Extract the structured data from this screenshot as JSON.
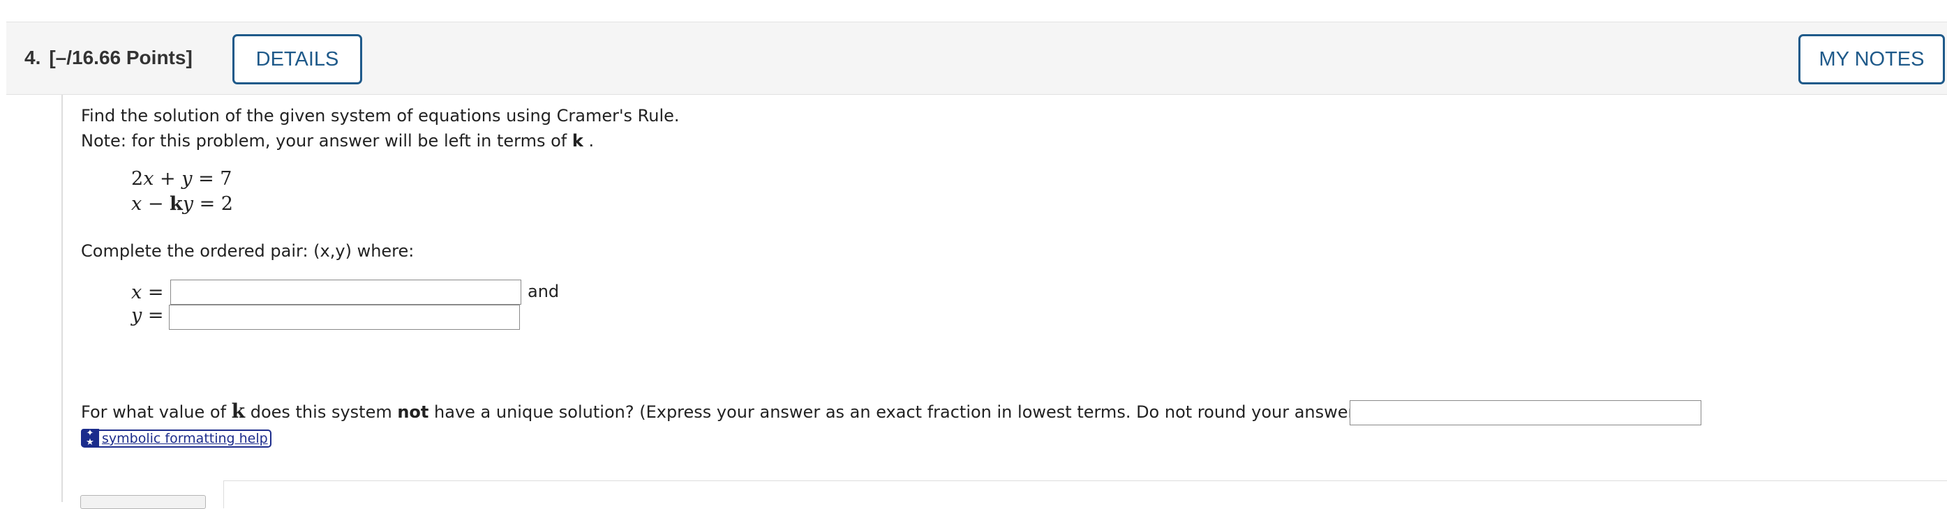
{
  "header": {
    "question_number": "4.",
    "points": "[–/16.66 Points]",
    "details_label": "DETAILS",
    "my_notes_label": "MY NOTES"
  },
  "problem": {
    "instruction": "Find the solution of the given system of equations using Cramer's Rule.",
    "note_prefix": "Note: for this problem, your answer will be left in terms of ",
    "note_k": "k",
    "note_suffix": " .",
    "equations": [
      {
        "a": "2",
        "v1": "x",
        "op": " + ",
        "v2": "y",
        "rhs": " = 7"
      },
      {
        "v1": "x",
        "op": " − ",
        "k": "k",
        "v2": "y",
        "rhs": " = 2"
      }
    ],
    "pair_prompt": "Complete the ordered pair: (x,y) where:",
    "x_label_var": "x",
    "y_label_var": "y",
    "equals": " =",
    "x_value": "",
    "y_value": "",
    "and_text": "and",
    "unique_prefix": "For what value of ",
    "unique_k": "k",
    "unique_mid": " does this system ",
    "unique_not": "not",
    "unique_suffix": " have a unique solution? (Express your answer as an exact fraction in lowest terms. Do not round your answer.)",
    "k_value": "",
    "help_link": "symbolic formatting help",
    "help_icon": "star-symbols-icon"
  },
  "colors": {
    "accent": "#1f5a8a",
    "help_blue": "#1a2c8c",
    "header_bg": "#f5f5f5"
  }
}
